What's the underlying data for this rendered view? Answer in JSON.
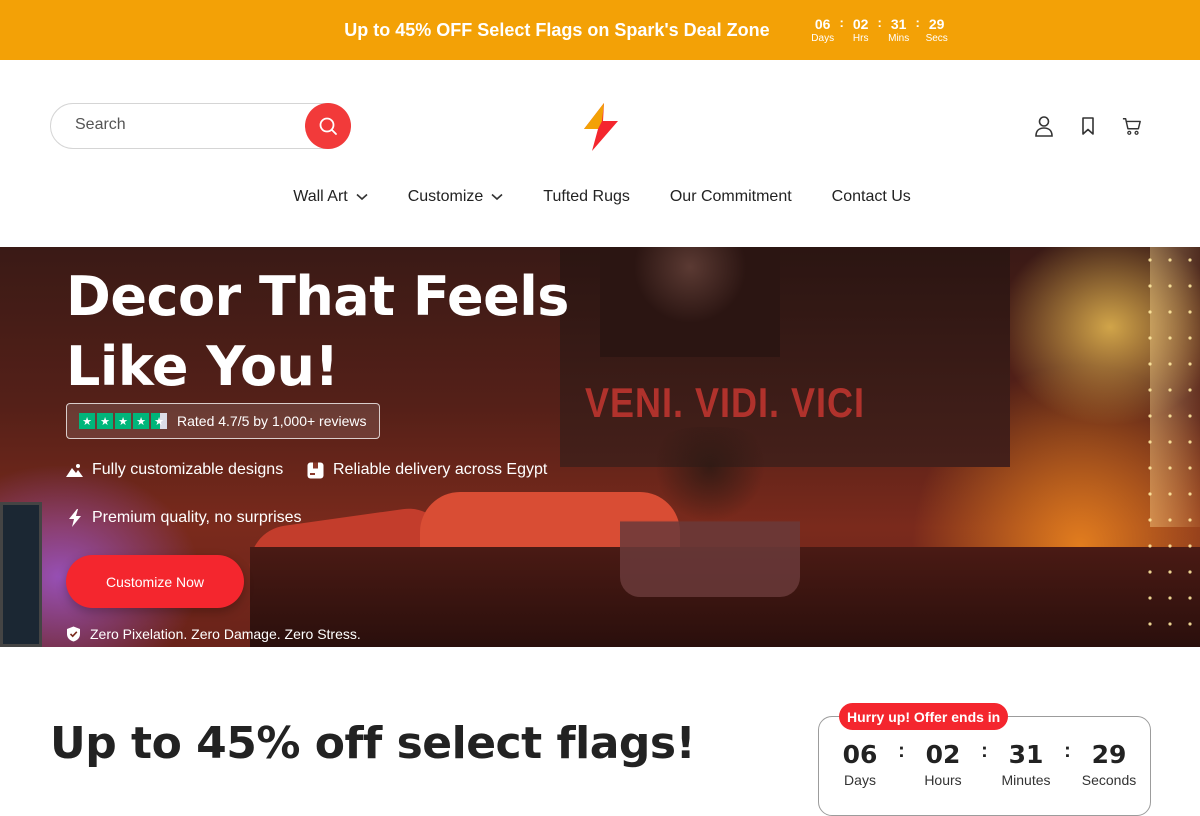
{
  "announcement": {
    "text": "Up to 45% OFF Select Flags on Spark's Deal Zone",
    "countdown": [
      {
        "value": "06",
        "label": "Days"
      },
      {
        "value": "02",
        "label": "Hrs"
      },
      {
        "value": "31",
        "label": "Mins"
      },
      {
        "value": "29",
        "label": "Secs"
      }
    ]
  },
  "header": {
    "search_placeholder": "Search",
    "icons": [
      "user-icon",
      "bookmark-icon",
      "cart-icon"
    ],
    "nav": [
      {
        "label": "Wall Art",
        "has_dropdown": true
      },
      {
        "label": "Customize",
        "has_dropdown": true
      },
      {
        "label": "Tufted Rugs",
        "has_dropdown": false
      },
      {
        "label": "Our Commitment",
        "has_dropdown": false
      },
      {
        "label": "Contact Us",
        "has_dropdown": false
      }
    ]
  },
  "hero": {
    "title_line1": "Decor That Feels",
    "title_line2": "Like You!",
    "rating_stars": 4.5,
    "rating_text": "Rated 4.7/5 by 1,000+ reviews",
    "features": [
      {
        "icon": "image-icon",
        "text": "Fully customizable designs"
      },
      {
        "icon": "package-icon",
        "text": "Reliable delivery across Egypt"
      },
      {
        "icon": "lightning-icon",
        "text": "Premium quality, no surprises"
      }
    ],
    "cta_label": "Customize Now",
    "guarantee_text": "Zero Pixelation. Zero Damage. Zero Stress.",
    "backdrop_text": "VENI. VIDI. VICI"
  },
  "sale": {
    "title": "Up to 45% off select flags!",
    "badge": "Hurry up! Offer ends in",
    "countdown": [
      {
        "value": "06",
        "label": "Days"
      },
      {
        "value": "02",
        "label": "Hours"
      },
      {
        "value": "31",
        "label": "Minutes"
      },
      {
        "value": "29",
        "label": "Seconds"
      }
    ]
  },
  "colors": {
    "announcement_bg": "#f3a106",
    "accent_red": "#f4262e",
    "trustpilot_green": "#00b67a"
  }
}
